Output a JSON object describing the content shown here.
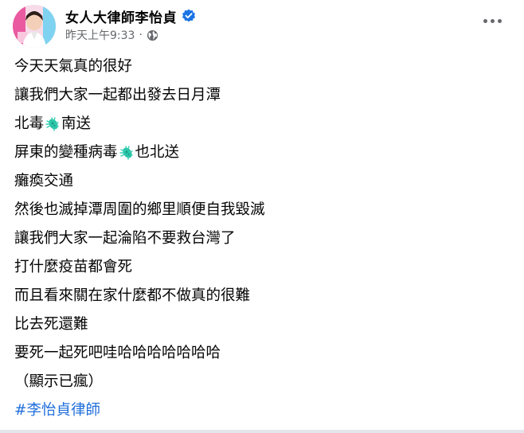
{
  "post": {
    "author": "女人大律師李怡貞",
    "timestamp": "昨天上午9:33",
    "separator": "·",
    "privacy_icon": "globe-icon",
    "verified_icon": "verified-badge-icon",
    "more_icon": "more-options-icon"
  },
  "content": {
    "lines": [
      {
        "parts": [
          "今天天氣真的很好"
        ]
      },
      {
        "parts": [
          "讓我們大家一起都出發去日月潭"
        ]
      },
      {
        "parts": [
          "北毒",
          "南送"
        ],
        "icon": "microbe-emoji-icon"
      },
      {
        "parts": [
          "屏東的變種病毒",
          "也北送"
        ],
        "icon": "microbe-emoji-icon"
      },
      {
        "parts": [
          "癱瘓交通"
        ]
      },
      {
        "parts": [
          "然後也滅掉潭周圍的鄉里順便自我毀滅"
        ]
      },
      {
        "parts": [
          "讓我們大家一起淪陷不要救台灣了"
        ]
      },
      {
        "parts": [
          "打什麼疫苗都會死"
        ]
      },
      {
        "parts": [
          "而且看來關在家什麼都不做真的很難"
        ]
      },
      {
        "parts": [
          "比去死還難"
        ]
      },
      {
        "parts": [
          "要死一起死吧哇哈哈哈哈哈哈哈"
        ]
      },
      {
        "parts": [
          "（顯示已瘋）"
        ]
      }
    ],
    "hashtag": "#李怡貞律師"
  },
  "colors": {
    "text": "#050505",
    "secondary": "#65676b",
    "link": "#216fdb",
    "verified": "#1b74e4",
    "emoji": "#2cc4a8"
  }
}
